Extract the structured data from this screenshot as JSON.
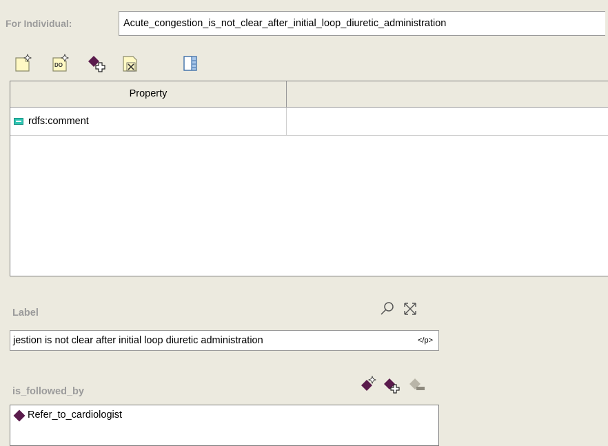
{
  "individual": {
    "label": "For Individual:",
    "value": "Acute_congestion_is_not_clear_after_initial_loop_diuretic_administration"
  },
  "toolbar": {
    "buttons": [
      "create-property-icon",
      "create-datatype-icon",
      "add-value-icon",
      "delete-value-icon",
      "view-columns-icon"
    ]
  },
  "table": {
    "columns": [
      "Property",
      ""
    ],
    "rows": [
      {
        "property": "rdfs:comment",
        "value": ""
      }
    ]
  },
  "label_section": {
    "title": "Label",
    "value": "jestion is not clear after initial loop diuretic administration",
    "tag": "</p>"
  },
  "followed_section": {
    "title": "is_followed_by",
    "items": [
      "Refer_to_cardiologist"
    ]
  }
}
